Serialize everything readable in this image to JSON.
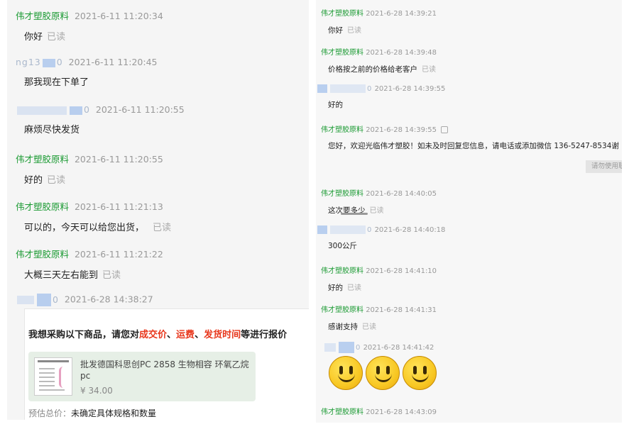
{
  "left_messages": [
    {
      "sender": "伟才塑胶原料",
      "masked": false,
      "time": "2021-6-11 11:20:34",
      "text": "你好",
      "read": "已读"
    },
    {
      "sender": "ng13",
      "masked": true,
      "sender_tail": "0",
      "time": "2021-6-11 11:20:45",
      "text": "那我现在下单了",
      "read": ""
    },
    {
      "sender": "",
      "masked": true,
      "sender_tail": "0",
      "time": "2021-6-11 11:20:55",
      "text": "麻烦尽快发货",
      "read": ""
    },
    {
      "sender": "伟才塑胶原料",
      "masked": false,
      "time": "2021-6-11 11:20:55",
      "text": "好的",
      "read": "已读"
    },
    {
      "sender": "伟才塑胶原料",
      "masked": false,
      "time": "2021-6-11 11:21:13",
      "text": "可以的，今天可以给您出货，",
      "read": "已读"
    },
    {
      "sender": "伟才塑胶原料",
      "masked": false,
      "time": "2021-6-11 11:21:22",
      "text": "大概三天左右能到",
      "read": "已读"
    },
    {
      "sender": "",
      "masked": true,
      "sender_tail": "0",
      "time": "2021-6-28 14:38:27",
      "text": "",
      "read": ""
    }
  ],
  "order_card": {
    "title_pre": "我想采购以下商品，请您对",
    "hl1": "成交价",
    "sep1": "、",
    "hl2": "运费",
    "sep2": "、",
    "hl3": "发货时间",
    "title_post": "等进行报价",
    "product_name": "批发德国科思创PC 2858 生物相容 环氧乙烷pc",
    "price": "¥ 34.00",
    "estimate_label": "预估总价：",
    "estimate_value": "未确定具体规格和数量"
  },
  "right_messages": [
    {
      "sender": "伟才塑胶原料",
      "masked": false,
      "time": "2021-6-28 14:39:21",
      "text": "你好",
      "read": "已读"
    },
    {
      "sender": "伟才塑胶原料",
      "masked": false,
      "time": "2021-6-28 14:39:48",
      "text": "价格按之前的价格给老客户",
      "read": "已读"
    },
    {
      "sender": "",
      "masked": true,
      "sender_tail": "0",
      "time": "2021-6-28 14:39:55",
      "text": "好的",
      "read": ""
    },
    {
      "sender": "伟才塑胶原料",
      "masked": false,
      "time": "2021-6-28 14:39:55",
      "text": "您好，欢迎光临伟才塑胶！如未及时回复您信息，请电话或添加微信  136-5247-8534谢",
      "read": ""
    },
    {
      "sender": "伟才塑胶原料",
      "masked": false,
      "time": "2021-6-28 14:40:05",
      "text": "这次要多少",
      "read": "已读"
    },
    {
      "sender": "",
      "masked": true,
      "sender_tail": "0",
      "time": "2021-6-28 14:40:18",
      "text": "300公斤",
      "read": ""
    },
    {
      "sender": "伟才塑胶原料",
      "masked": false,
      "time": "2021-6-28 14:41:10",
      "text": "好的",
      "read": "已读"
    },
    {
      "sender": "伟才塑胶原料",
      "masked": false,
      "time": "2021-6-28 14:41:31",
      "text": "感谢支持",
      "read": "已读"
    },
    {
      "sender": "",
      "masked": true,
      "sender_tail": "0",
      "time": "2021-6-28 14:41:42",
      "text": "",
      "read": ""
    },
    {
      "sender": "伟才塑胶原料",
      "masked": false,
      "time": "2021-6-28 14:43:09",
      "text": "",
      "read": ""
    }
  ],
  "auto_reply_notice": "请勿使用联"
}
